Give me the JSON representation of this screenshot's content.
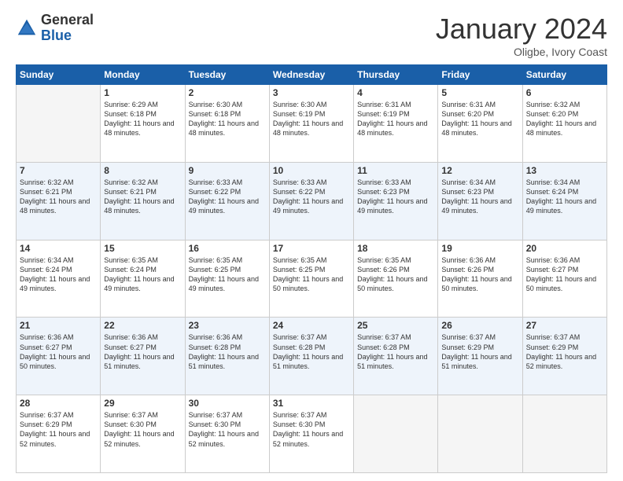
{
  "header": {
    "logo": {
      "general": "General",
      "blue": "Blue"
    },
    "title": "January 2024",
    "location": "Oligbe, Ivory Coast"
  },
  "weekdays": [
    "Sunday",
    "Monday",
    "Tuesday",
    "Wednesday",
    "Thursday",
    "Friday",
    "Saturday"
  ],
  "weeks": [
    [
      {
        "day": null,
        "sunrise": null,
        "sunset": null,
        "daylight": null
      },
      {
        "day": "1",
        "sunrise": "Sunrise: 6:29 AM",
        "sunset": "Sunset: 6:18 PM",
        "daylight": "Daylight: 11 hours and 48 minutes."
      },
      {
        "day": "2",
        "sunrise": "Sunrise: 6:30 AM",
        "sunset": "Sunset: 6:18 PM",
        "daylight": "Daylight: 11 hours and 48 minutes."
      },
      {
        "day": "3",
        "sunrise": "Sunrise: 6:30 AM",
        "sunset": "Sunset: 6:19 PM",
        "daylight": "Daylight: 11 hours and 48 minutes."
      },
      {
        "day": "4",
        "sunrise": "Sunrise: 6:31 AM",
        "sunset": "Sunset: 6:19 PM",
        "daylight": "Daylight: 11 hours and 48 minutes."
      },
      {
        "day": "5",
        "sunrise": "Sunrise: 6:31 AM",
        "sunset": "Sunset: 6:20 PM",
        "daylight": "Daylight: 11 hours and 48 minutes."
      },
      {
        "day": "6",
        "sunrise": "Sunrise: 6:32 AM",
        "sunset": "Sunset: 6:20 PM",
        "daylight": "Daylight: 11 hours and 48 minutes."
      }
    ],
    [
      {
        "day": "7",
        "sunrise": "Sunrise: 6:32 AM",
        "sunset": "Sunset: 6:21 PM",
        "daylight": "Daylight: 11 hours and 48 minutes."
      },
      {
        "day": "8",
        "sunrise": "Sunrise: 6:32 AM",
        "sunset": "Sunset: 6:21 PM",
        "daylight": "Daylight: 11 hours and 48 minutes."
      },
      {
        "day": "9",
        "sunrise": "Sunrise: 6:33 AM",
        "sunset": "Sunset: 6:22 PM",
        "daylight": "Daylight: 11 hours and 49 minutes."
      },
      {
        "day": "10",
        "sunrise": "Sunrise: 6:33 AM",
        "sunset": "Sunset: 6:22 PM",
        "daylight": "Daylight: 11 hours and 49 minutes."
      },
      {
        "day": "11",
        "sunrise": "Sunrise: 6:33 AM",
        "sunset": "Sunset: 6:23 PM",
        "daylight": "Daylight: 11 hours and 49 minutes."
      },
      {
        "day": "12",
        "sunrise": "Sunrise: 6:34 AM",
        "sunset": "Sunset: 6:23 PM",
        "daylight": "Daylight: 11 hours and 49 minutes."
      },
      {
        "day": "13",
        "sunrise": "Sunrise: 6:34 AM",
        "sunset": "Sunset: 6:24 PM",
        "daylight": "Daylight: 11 hours and 49 minutes."
      }
    ],
    [
      {
        "day": "14",
        "sunrise": "Sunrise: 6:34 AM",
        "sunset": "Sunset: 6:24 PM",
        "daylight": "Daylight: 11 hours and 49 minutes."
      },
      {
        "day": "15",
        "sunrise": "Sunrise: 6:35 AM",
        "sunset": "Sunset: 6:24 PM",
        "daylight": "Daylight: 11 hours and 49 minutes."
      },
      {
        "day": "16",
        "sunrise": "Sunrise: 6:35 AM",
        "sunset": "Sunset: 6:25 PM",
        "daylight": "Daylight: 11 hours and 49 minutes."
      },
      {
        "day": "17",
        "sunrise": "Sunrise: 6:35 AM",
        "sunset": "Sunset: 6:25 PM",
        "daylight": "Daylight: 11 hours and 50 minutes."
      },
      {
        "day": "18",
        "sunrise": "Sunrise: 6:35 AM",
        "sunset": "Sunset: 6:26 PM",
        "daylight": "Daylight: 11 hours and 50 minutes."
      },
      {
        "day": "19",
        "sunrise": "Sunrise: 6:36 AM",
        "sunset": "Sunset: 6:26 PM",
        "daylight": "Daylight: 11 hours and 50 minutes."
      },
      {
        "day": "20",
        "sunrise": "Sunrise: 6:36 AM",
        "sunset": "Sunset: 6:27 PM",
        "daylight": "Daylight: 11 hours and 50 minutes."
      }
    ],
    [
      {
        "day": "21",
        "sunrise": "Sunrise: 6:36 AM",
        "sunset": "Sunset: 6:27 PM",
        "daylight": "Daylight: 11 hours and 50 minutes."
      },
      {
        "day": "22",
        "sunrise": "Sunrise: 6:36 AM",
        "sunset": "Sunset: 6:27 PM",
        "daylight": "Daylight: 11 hours and 51 minutes."
      },
      {
        "day": "23",
        "sunrise": "Sunrise: 6:36 AM",
        "sunset": "Sunset: 6:28 PM",
        "daylight": "Daylight: 11 hours and 51 minutes."
      },
      {
        "day": "24",
        "sunrise": "Sunrise: 6:37 AM",
        "sunset": "Sunset: 6:28 PM",
        "daylight": "Daylight: 11 hours and 51 minutes."
      },
      {
        "day": "25",
        "sunrise": "Sunrise: 6:37 AM",
        "sunset": "Sunset: 6:28 PM",
        "daylight": "Daylight: 11 hours and 51 minutes."
      },
      {
        "day": "26",
        "sunrise": "Sunrise: 6:37 AM",
        "sunset": "Sunset: 6:29 PM",
        "daylight": "Daylight: 11 hours and 51 minutes."
      },
      {
        "day": "27",
        "sunrise": "Sunrise: 6:37 AM",
        "sunset": "Sunset: 6:29 PM",
        "daylight": "Daylight: 11 hours and 52 minutes."
      }
    ],
    [
      {
        "day": "28",
        "sunrise": "Sunrise: 6:37 AM",
        "sunset": "Sunset: 6:29 PM",
        "daylight": "Daylight: 11 hours and 52 minutes."
      },
      {
        "day": "29",
        "sunrise": "Sunrise: 6:37 AM",
        "sunset": "Sunset: 6:30 PM",
        "daylight": "Daylight: 11 hours and 52 minutes."
      },
      {
        "day": "30",
        "sunrise": "Sunrise: 6:37 AM",
        "sunset": "Sunset: 6:30 PM",
        "daylight": "Daylight: 11 hours and 52 minutes."
      },
      {
        "day": "31",
        "sunrise": "Sunrise: 6:37 AM",
        "sunset": "Sunset: 6:30 PM",
        "daylight": "Daylight: 11 hours and 52 minutes."
      },
      {
        "day": null,
        "sunrise": null,
        "sunset": null,
        "daylight": null
      },
      {
        "day": null,
        "sunrise": null,
        "sunset": null,
        "daylight": null
      },
      {
        "day": null,
        "sunrise": null,
        "sunset": null,
        "daylight": null
      }
    ]
  ]
}
